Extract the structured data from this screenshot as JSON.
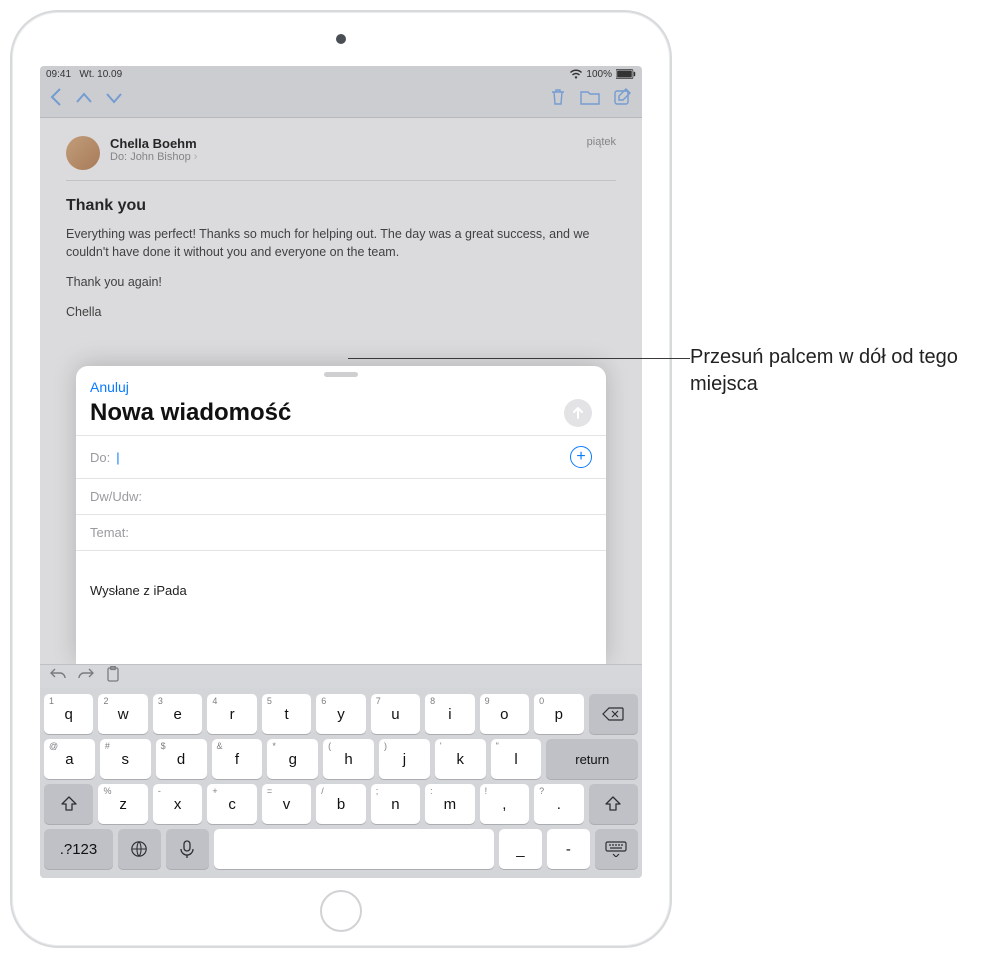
{
  "status": {
    "time": "09:41",
    "date": "Wt. 10.09",
    "battery": "100%"
  },
  "mail": {
    "from": "Chella Boehm",
    "to_label": "Do:",
    "to_name": "John Bishop",
    "date": "piątek",
    "subject": "Thank you",
    "body1": "Everything was perfect! Thanks so much for helping out. The day was a great success, and we couldn't have done it without you and everyone on the team.",
    "body2": "Thank you again!",
    "body3": "Chella"
  },
  "compose": {
    "cancel": "Anuluj",
    "title": "Nowa wiadomość",
    "to_label": "Do:",
    "cc_label": "Dw/Udw:",
    "subject_label": "Temat:",
    "signature": "Wysłane z iPada"
  },
  "keyboard": {
    "row1": [
      {
        "k": "q",
        "a": "1"
      },
      {
        "k": "w",
        "a": "2"
      },
      {
        "k": "e",
        "a": "3"
      },
      {
        "k": "r",
        "a": "4"
      },
      {
        "k": "t",
        "a": "5"
      },
      {
        "k": "y",
        "a": "6"
      },
      {
        "k": "u",
        "a": "7"
      },
      {
        "k": "i",
        "a": "8"
      },
      {
        "k": "o",
        "a": "9"
      },
      {
        "k": "p",
        "a": "0"
      }
    ],
    "row2": [
      {
        "k": "a",
        "a": "@"
      },
      {
        "k": "s",
        "a": "#"
      },
      {
        "k": "d",
        "a": "$"
      },
      {
        "k": "f",
        "a": "&"
      },
      {
        "k": "g",
        "a": "*"
      },
      {
        "k": "h",
        "a": "("
      },
      {
        "k": "j",
        "a": ")"
      },
      {
        "k": "k",
        "a": "'"
      },
      {
        "k": "l",
        "a": "\""
      }
    ],
    "row3": [
      {
        "k": "z",
        "a": "%"
      },
      {
        "k": "x",
        "a": "-"
      },
      {
        "k": "c",
        "a": "+"
      },
      {
        "k": "v",
        "a": "="
      },
      {
        "k": "b",
        "a": "/"
      },
      {
        "k": "n",
        "a": ";"
      },
      {
        "k": "m",
        "a": ":"
      },
      {
        "k": ",",
        "a": "!"
      },
      {
        "k": ".",
        "a": "?"
      }
    ],
    "numkey": ".?123",
    "return": "return",
    "row4punct": [
      "_",
      "-"
    ]
  },
  "callout": "Przesuń palcem w dół od tego miejsca"
}
